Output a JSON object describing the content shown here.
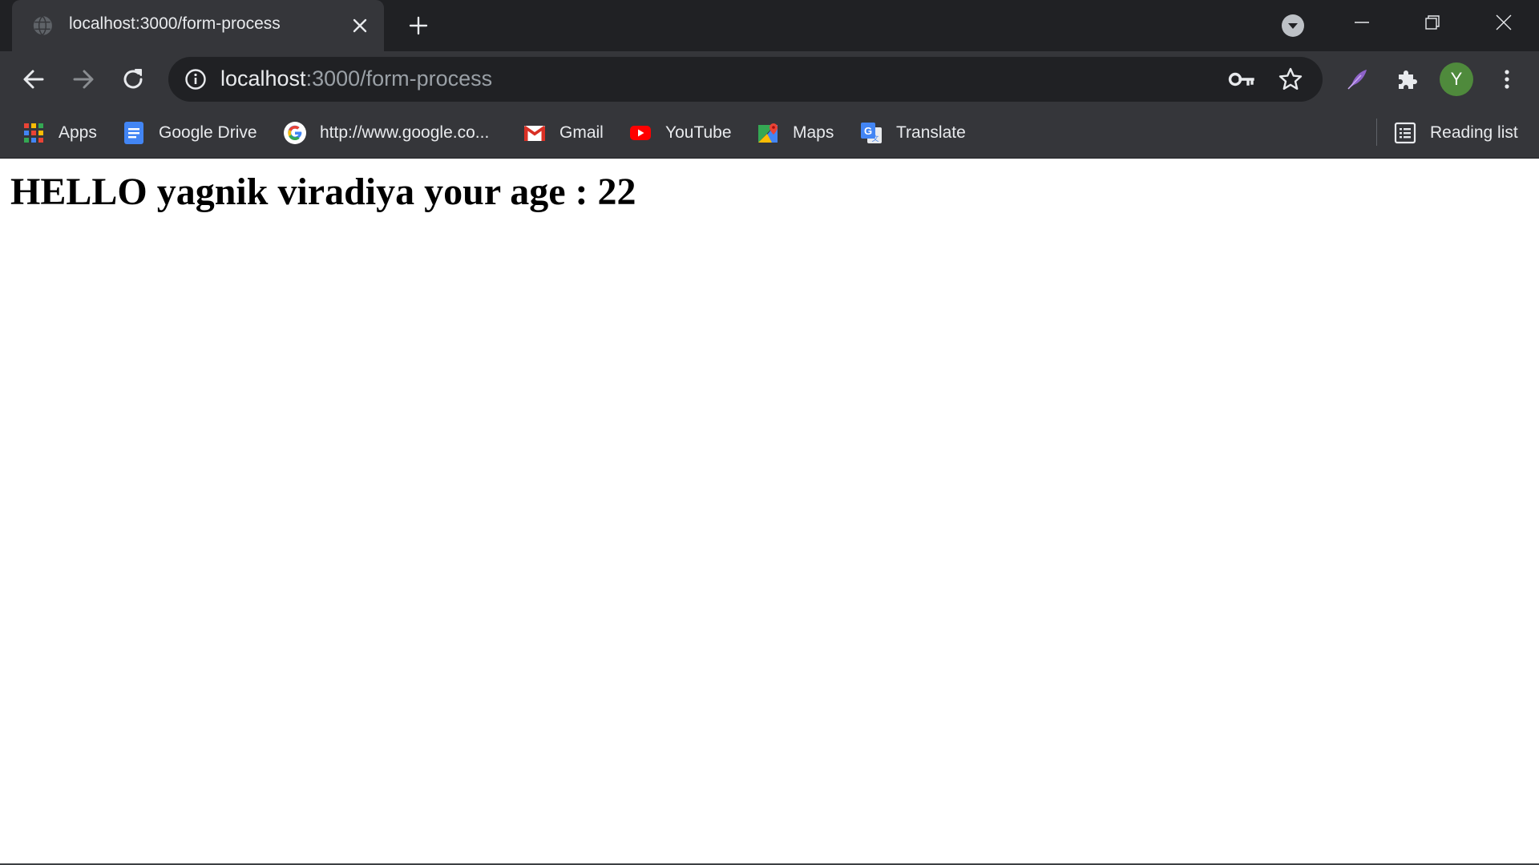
{
  "tab": {
    "title": "localhost:3000/form-process"
  },
  "omnibox": {
    "host": "localhost",
    "path": ":3000/form-process"
  },
  "profile": {
    "initial": "Y"
  },
  "bookmarks": [
    {
      "label": "Apps",
      "icon": "apps-grid-icon"
    },
    {
      "label": "Google Drive",
      "icon": "google-docs-icon"
    },
    {
      "label": "http://www.google.co...",
      "icon": "google-icon"
    },
    {
      "label": "Gmail",
      "icon": "gmail-icon"
    },
    {
      "label": "YouTube",
      "icon": "youtube-icon"
    },
    {
      "label": "Maps",
      "icon": "maps-icon"
    },
    {
      "label": "Translate",
      "icon": "translate-icon"
    }
  ],
  "reading_list": {
    "label": "Reading list"
  },
  "page": {
    "greeting": "HELLO yagnik viradiya your age : 22"
  },
  "colors": {
    "tabstrip_bg": "#202124",
    "toolbar_bg": "#35363a",
    "text_light": "#e8eaed",
    "text_muted": "#9aa0a6",
    "avatar_bg": "#4f8a3c"
  }
}
